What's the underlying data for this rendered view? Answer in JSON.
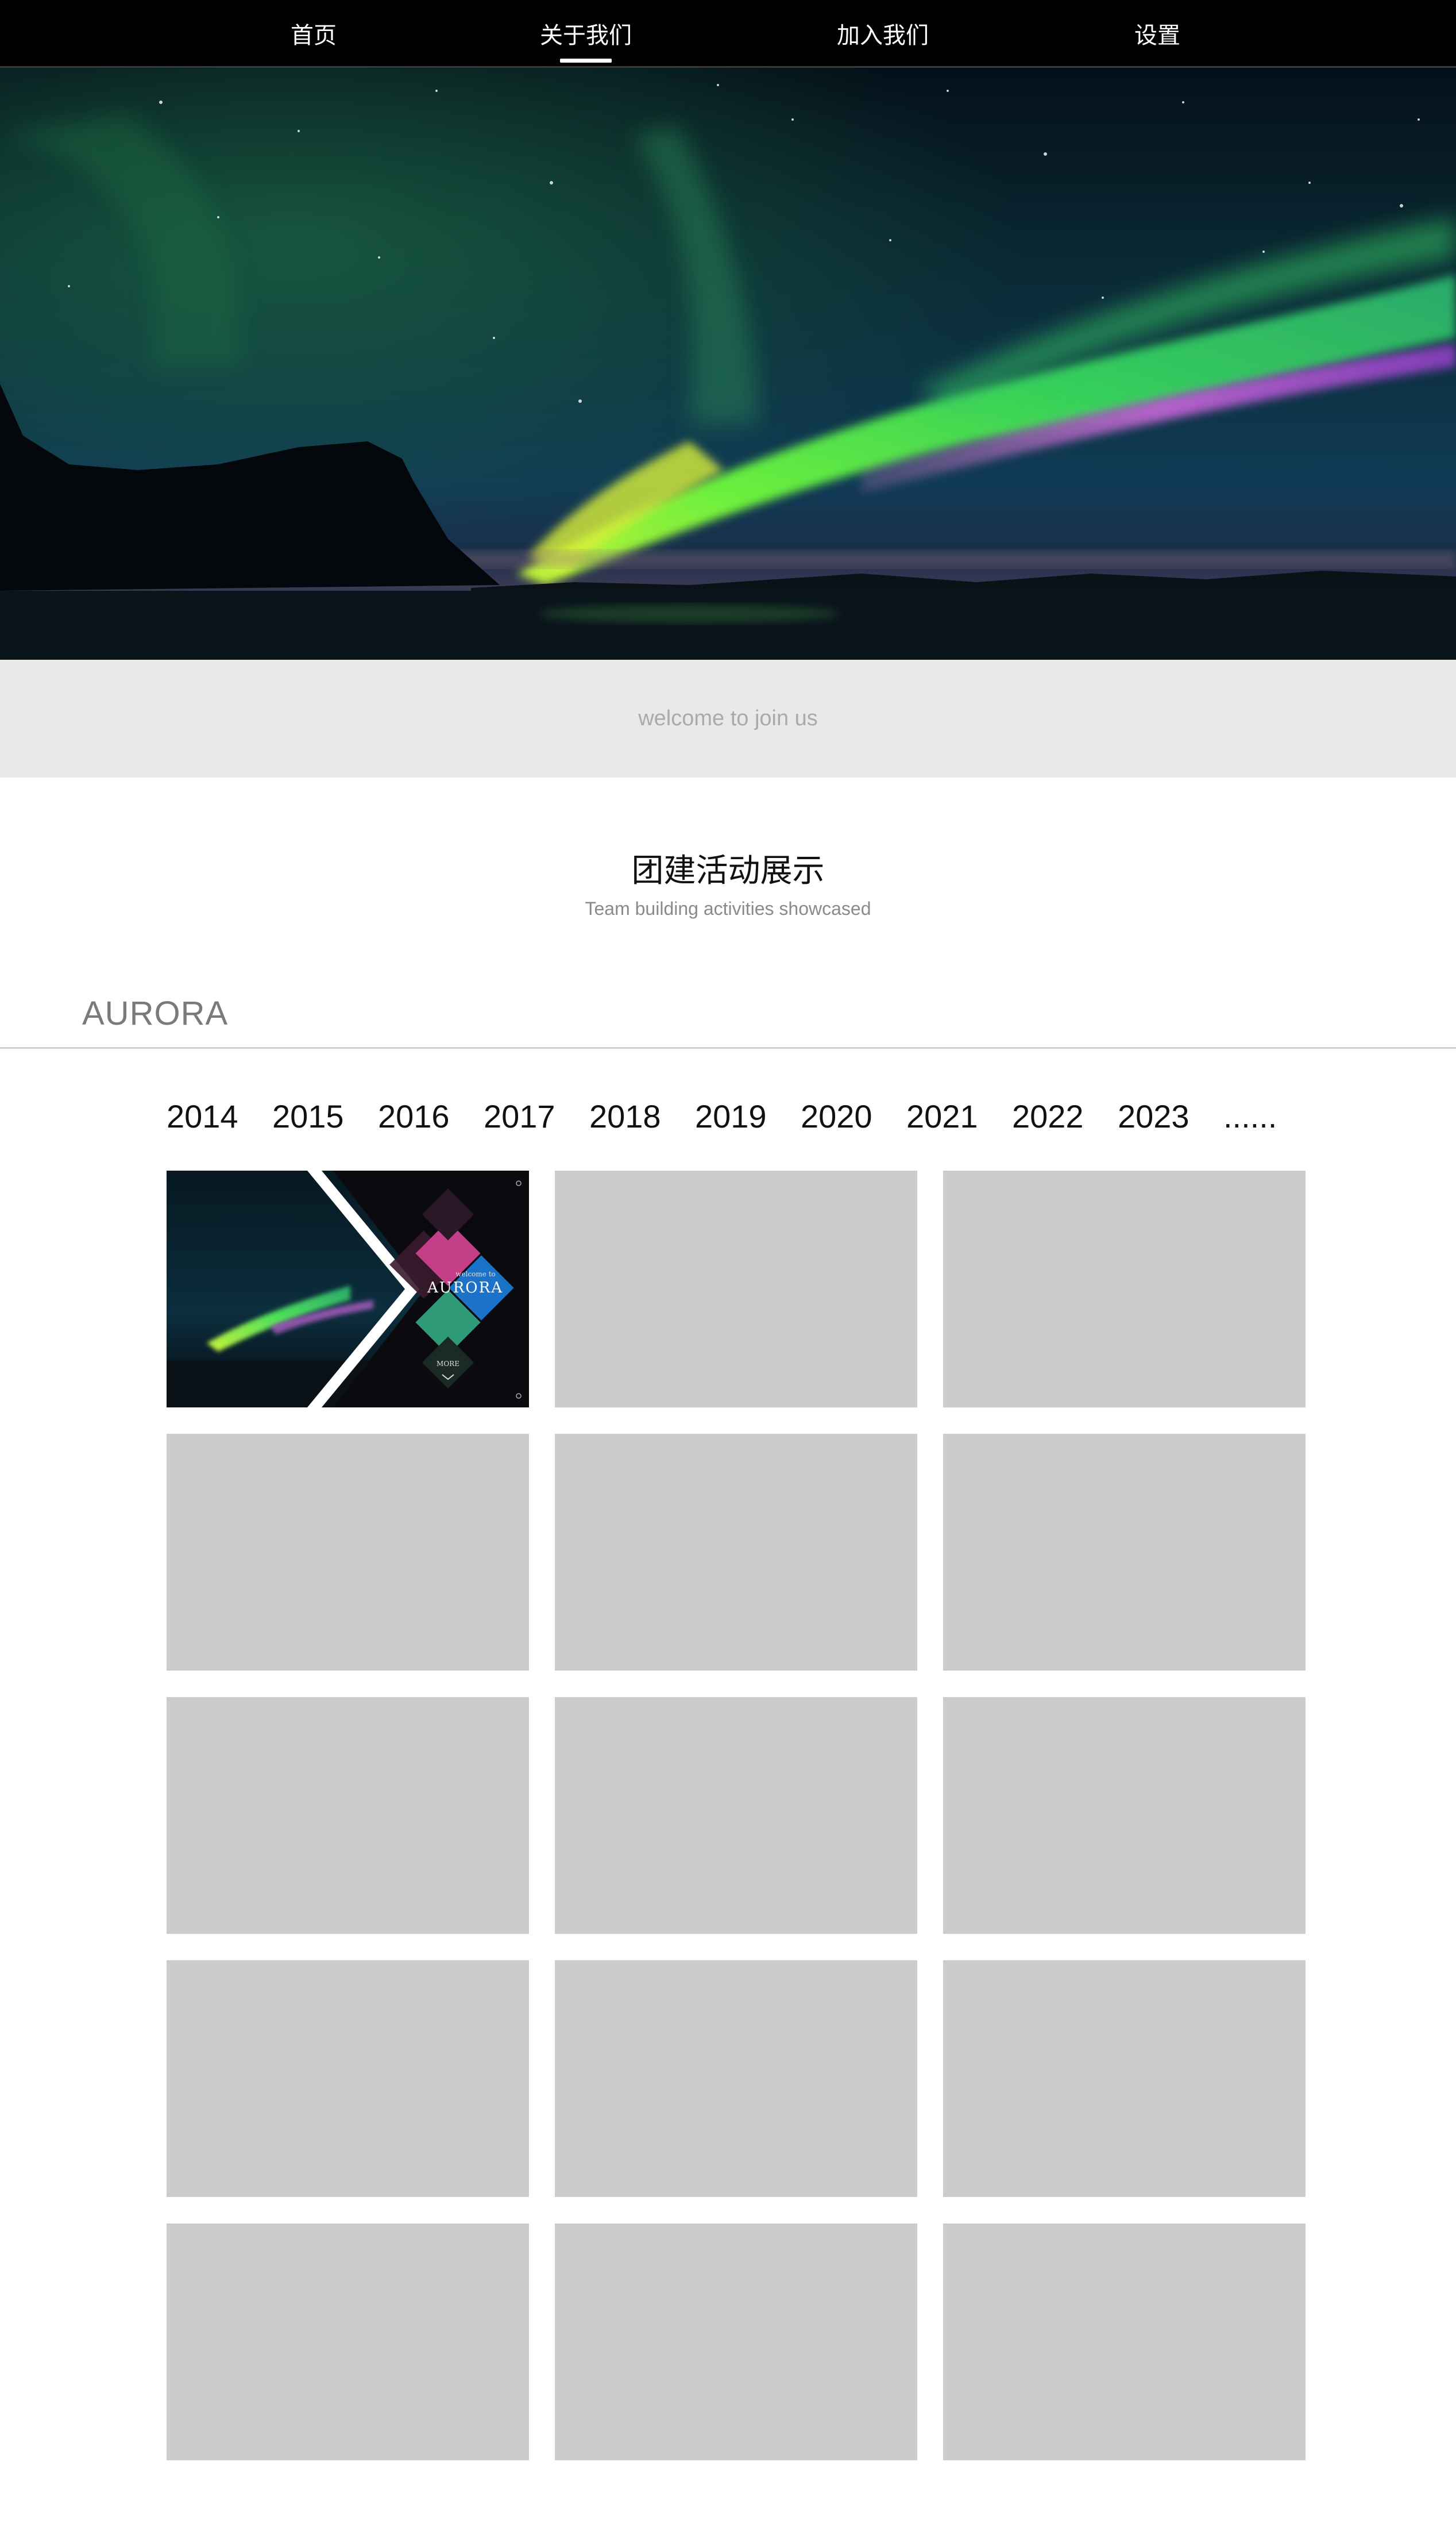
{
  "nav": {
    "items": [
      {
        "label": "首页",
        "active": false
      },
      {
        "label": "关于我们",
        "active": true
      },
      {
        "label": "加入我们",
        "active": false
      },
      {
        "label": "设置",
        "active": false
      }
    ]
  },
  "hero": {
    "image": "aurora-borealis-photo"
  },
  "welcome": {
    "text": "welcome to join us"
  },
  "section": {
    "title": "团建活动展示",
    "subtitle": "Team building activities showcased"
  },
  "brand": {
    "label": "AURORA"
  },
  "years": [
    "2014",
    "2015",
    "2016",
    "2017",
    "2018",
    "2019",
    "2020",
    "2021",
    "2022",
    "2023",
    "......"
  ],
  "thumbnail": {
    "welcome": "welcome to",
    "brand": "AURORA",
    "more": "MORE"
  },
  "grid": {
    "placeholder_count": 14
  },
  "colors": {
    "nav_bg": "#000000",
    "band_bg": "#e9e9e9",
    "placeholder": "#cccccc"
  }
}
